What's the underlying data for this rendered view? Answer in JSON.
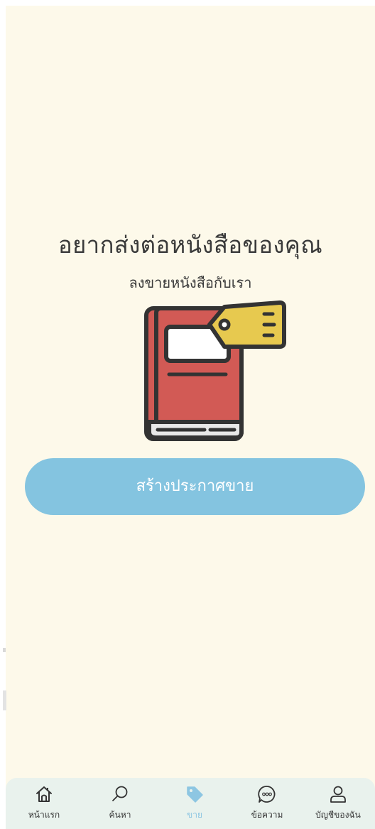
{
  "hero": {
    "title": "อยากส่งต่อหนังสือของคุณ",
    "subtitle": "ลงขายหนังสือกับเรา",
    "illustration_icon": "book-with-price-tag-icon"
  },
  "cta": {
    "label": "สร้างประกาศขาย"
  },
  "bottom_nav": {
    "items": [
      {
        "label": "หน้าแรก",
        "icon": "home-icon",
        "active": false
      },
      {
        "label": "ค้นหา",
        "icon": "search-icon",
        "active": false
      },
      {
        "label": "ขาย",
        "icon": "tag-icon",
        "active": true
      },
      {
        "label": "ข้อความ",
        "icon": "chat-bubble-icon",
        "active": false
      },
      {
        "label": "บัญชีของฉัน",
        "icon": "user-icon",
        "active": false
      }
    ]
  },
  "colors": {
    "background": "#fdf9ea",
    "accent": "#84c4e0",
    "active_nav": "#8dc6e2",
    "nav_background": "#e9f2ed",
    "text": "#3a3a3a",
    "book_red": "#d25a55",
    "tag_yellow": "#e7c94f"
  }
}
